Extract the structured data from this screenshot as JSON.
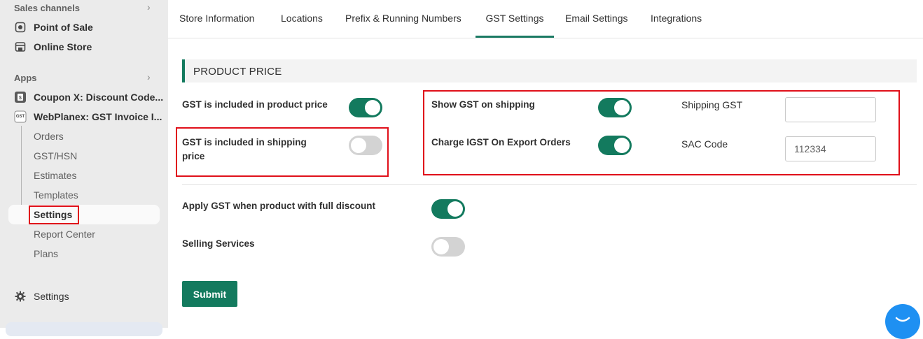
{
  "sidebar": {
    "sales_channels_label": "Sales channels",
    "point_of_sale": "Point of Sale",
    "online_store": "Online Store",
    "apps_label": "Apps",
    "coupon_app": "Coupon X: Discount Code...",
    "gst_app": "WebPlanex: GST Invoice I...",
    "gst_app_badge": "GST",
    "subitems": [
      "Orders",
      "GST/HSN",
      "Estimates",
      "Templates",
      "Settings",
      "Report Center",
      "Plans"
    ],
    "settings": "Settings",
    "chevron": "›"
  },
  "tabs": [
    "Store Information",
    "Locations",
    "Prefix & Running Numbers",
    "GST Settings",
    "Email Settings",
    "Integrations"
  ],
  "active_tab": "GST Settings",
  "section_title": "PRODUCT PRICE",
  "options": {
    "gst_included_product_price": {
      "label": "GST is included in product price",
      "on": true
    },
    "gst_included_shipping_price": {
      "label_line1": "GST is included in shipping",
      "label_line2": "price",
      "on": false
    },
    "show_gst_on_shipping": {
      "label": "Show GST on shipping",
      "on": true
    },
    "charge_igst_export": {
      "label": "Charge IGST On Export Orders",
      "on": true
    },
    "apply_gst_full_discount": {
      "label": "Apply GST when product with full discount",
      "on": true
    },
    "selling_services": {
      "label": "Selling Services",
      "on": false
    }
  },
  "fields": {
    "shipping_gst": {
      "label": "Shipping GST",
      "value": ""
    },
    "sac_code": {
      "label": "SAC Code",
      "value": "112334"
    }
  },
  "submit_label": "Submit",
  "colors": {
    "accent": "#137a5e",
    "highlight": "#e0101a",
    "chat": "#1e90f2"
  }
}
